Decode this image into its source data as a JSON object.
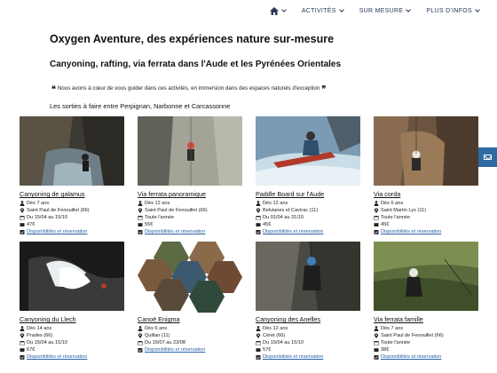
{
  "nav": {
    "items": [
      {
        "label": "ACTIVITÉS"
      },
      {
        "label": "SUR MESURE"
      },
      {
        "label": "PLUS D'INFOS"
      }
    ]
  },
  "heading": {
    "title": "Oxygen Aventure, des expériences nature sur-mesure",
    "subtitle": "Canyoning, rafting, via ferrata dans l'Aude et les Pyrénées Orientales",
    "quote": "Nous avons à cœur de vous guider dans ces activités, en immersion dans des espaces naturels d'exception",
    "section": "Les sorties à faire entre Perpignan, Narbonne et Carcassonne"
  },
  "cards": [
    {
      "title": "Canyoning de galamus",
      "age": "Dès 7 ans",
      "place": "Saint Paul de Fenouillet (66)",
      "dates": "Du 15/04 au 15/10",
      "price": "47€",
      "link": "Disponibilités et réservation"
    },
    {
      "title": "Via ferrata panoramique",
      "age": "Dès 12 ans",
      "place": "Saint Paul de Fenouillet (66)",
      "dates": "Toute l'année",
      "price": "55€",
      "link": "Disponibilités et réservation"
    },
    {
      "title": "Paddle Board sur l'Aude",
      "age": "Dès 12 ans",
      "place": "Belvianes et Cavirac (11)",
      "dates": "Du 01/04 au 31/10",
      "price": "45€",
      "link": "Disponibilités et réservation"
    },
    {
      "title": "Via corda",
      "age": "Dès 6 ans",
      "place": "Saint Martin Lys (11)",
      "dates": "Toute l'année",
      "price": "45€",
      "link": "Disponibilités et réservation"
    },
    {
      "title": "Canyoning du Llech",
      "age": "Dès 14 ans",
      "place": "Prades (66)",
      "dates": "Du 15/04 au 15/10",
      "price": "67€",
      "link": "Disponibilités et réservation"
    },
    {
      "title": "Canoë Enigma",
      "age": "Dès 6 ans",
      "place": "Quillan (11)",
      "dates": "Du 15/07 au 23/08",
      "price": "",
      "link": "Disponibilités et réservation"
    },
    {
      "title": "Canyoning des Anelles",
      "age": "Dès 12 ans",
      "place": "Céret (66)",
      "dates": "Du 15/04 au 15/10",
      "price": "57€",
      "link": "Disponibilités et réservation"
    },
    {
      "title": "Via ferrata famille",
      "age": "Dès 7 ans",
      "place": "Saint Paul de Fenouillet (66)",
      "dates": "Toute l'année",
      "price": "38€",
      "link": "Disponibilités et réservation"
    }
  ],
  "colors": {
    "accent": "#2f6aa3",
    "link": "#2a62a8",
    "nav": "#2a3a5a"
  }
}
